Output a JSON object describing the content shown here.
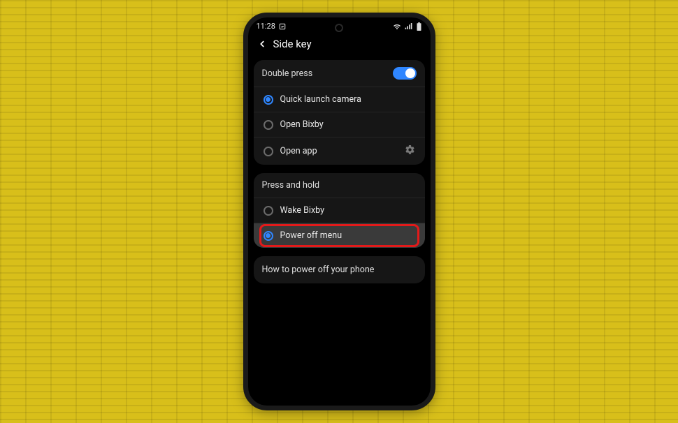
{
  "statusbar": {
    "time": "11:28"
  },
  "header": {
    "title": "Side key"
  },
  "sections": {
    "doublePress": {
      "title": "Double press",
      "toggle": true,
      "options": [
        {
          "label": "Quick launch camera",
          "selected": true,
          "gear": false
        },
        {
          "label": "Open Bixby",
          "selected": false,
          "gear": false
        },
        {
          "label": "Open app",
          "selected": false,
          "gear": true
        }
      ]
    },
    "pressHold": {
      "title": "Press and hold",
      "options": [
        {
          "label": "Wake Bixby",
          "selected": false,
          "highlighted": false
        },
        {
          "label": "Power off menu",
          "selected": true,
          "highlighted": true
        }
      ]
    },
    "info": {
      "label": "How to power off your phone"
    }
  }
}
